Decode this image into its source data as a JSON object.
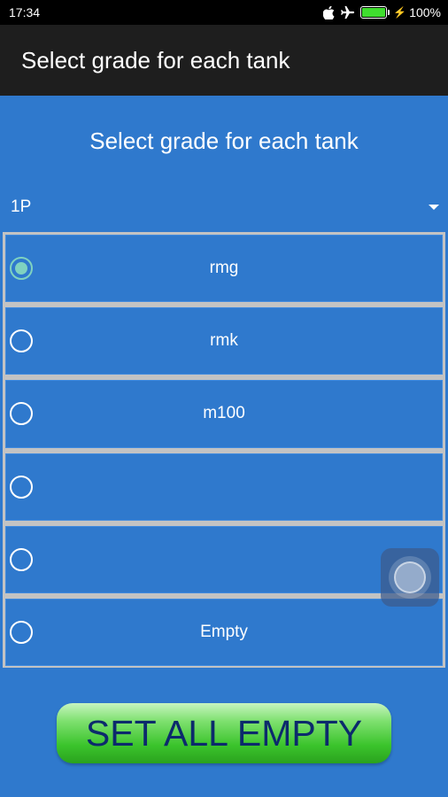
{
  "status_bar": {
    "time": "17:34",
    "battery_percent": "100%",
    "battery_level": 1.0,
    "icons": [
      "apple-icon",
      "airplane-icon",
      "battery-icon",
      "charging-bolt-icon"
    ]
  },
  "app_bar": {
    "title": "Select grade for each tank"
  },
  "main": {
    "heading": "Select grade for each tank",
    "tank_selector": {
      "selected": "1P"
    },
    "grade_options": [
      {
        "label": "rmg",
        "checked": true
      },
      {
        "label": "rmk",
        "checked": false
      },
      {
        "label": "m100",
        "checked": false
      },
      {
        "label": "",
        "checked": false
      },
      {
        "label": "",
        "checked": false
      },
      {
        "label": "Empty",
        "checked": false
      }
    ],
    "set_all_empty_label": "SET ALL EMPTY"
  },
  "colors": {
    "background": "#2f79cd",
    "app_bar": "#1e1e1e",
    "radio_checked": "#7fd2c0",
    "button_green": "#3bc42c",
    "button_text": "#0c2a6c"
  }
}
